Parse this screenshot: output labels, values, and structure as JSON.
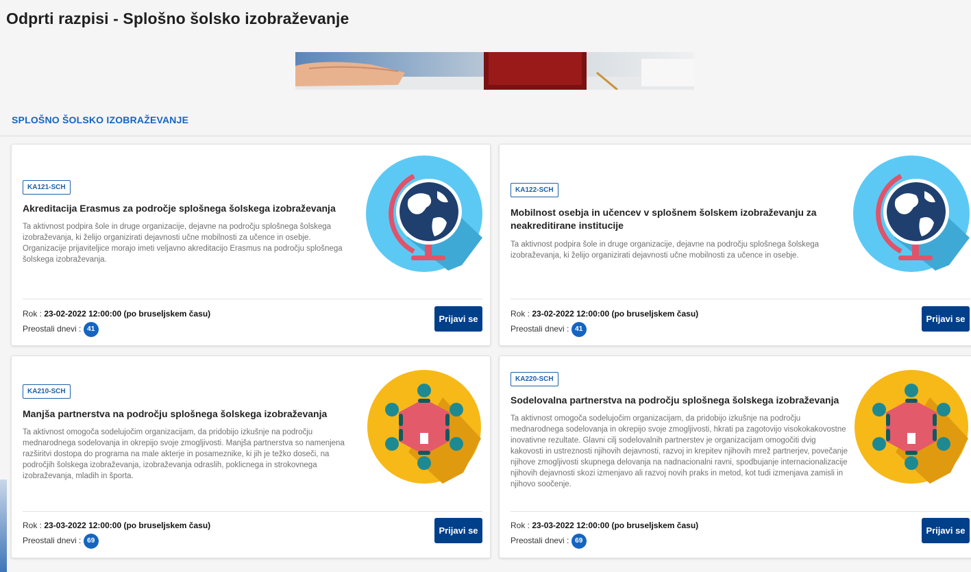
{
  "page": {
    "title": "Odprti razpisi - Splošno šolsko izobraževanje"
  },
  "section": {
    "title": "SPLOŠNO ŠOLSKO IZOBRAŽEVANJE"
  },
  "labels": {
    "deadline": "Rok :",
    "remaining": "Preostali dnevi :",
    "apply": "Prijavi se"
  },
  "colors": {
    "accent": "#1565c0",
    "button": "#003f8a",
    "globe_bg": "#5cc9f5",
    "partners_bg": "#f7b918"
  },
  "cards": [
    {
      "code": "KA121-SCH",
      "title": "Akreditacija Erasmus za področje splošnega šolskega izobraževanja",
      "description": "Ta aktivnost podpira šole in druge organizacije, dejavne na področju splošnega šolskega izobraževanja, ki želijo organizirati dejavnosti učne mobilnosti za učence in osebje. Organizacije prijaviteljice morajo imeti veljavno akreditacijo Erasmus na področju splošnega šolskega izobraževanja.",
      "deadline": "23-02-2022 12:00:00 (po bruseljskem času)",
      "days": "41",
      "icon": "globe-icon"
    },
    {
      "code": "KA122-SCH",
      "title": "Mobilnost osebja in učencev v splošnem šolskem izobraževanju za neakreditirane institucije",
      "description": "Ta aktivnost podpira šole in druge organizacije, dejavne na področju splošnega šolskega izobraževanja, ki želijo organizirati dejavnosti učne mobilnosti za učence in osebje.",
      "deadline": "23-02-2022 12:00:00 (po bruseljskem času)",
      "days": "41",
      "icon": "globe-icon"
    },
    {
      "code": "KA210-SCH",
      "title": "Manjša partnerstva na področju splošnega šolskega izobraževanja",
      "description": "Ta aktivnost omogoča sodelujočim organizacijam, da pridobijo izkušnje na področju mednarodnega sodelovanja in okrepijo svoje zmogljivosti. Manjša partnerstva so namenjena razširitvi dostopa do programa na male akterje in posameznike, ki jih je težko doseči, na področjih šolskega izobraževanja, izobraževanja odraslih, poklicnega in strokovnega izobraževanja, mladih in športa.",
      "deadline": "23-03-2022 12:00:00 (po bruseljskem času)",
      "days": "69",
      "icon": "meeting-table-icon"
    },
    {
      "code": "KA220-SCH",
      "title": "Sodelovalna partnerstva na področju splošnega šolskega izobraževanja",
      "description": "Ta aktivnost omogoča sodelujočim organizacijam, da pridobijo izkušnje na področju mednarodnega sodelovanja in okrepijo svoje zmogljivosti, hkrati pa zagotovijo visokokakovostne inovativne rezultate. Glavni cilj sodelovalnih partnerstev je organizacijam omogočiti dvig kakovosti in ustreznosti njihovih dejavnosti, razvoj in krepitev njihovih mrež partnerjev, povečanje njihove zmogljivosti skupnega delovanja na nadnacionalni ravni, spodbujanje internacionalizacije njihovih dejavnosti skozi izmenjavo ali razvoj novih praks in metod, kot tudi izmenjava zamisli in njihovo soočenje.",
      "deadline": "23-03-2022 12:00:00 (po bruseljskem času)",
      "days": "69",
      "icon": "meeting-table-icon"
    }
  ]
}
